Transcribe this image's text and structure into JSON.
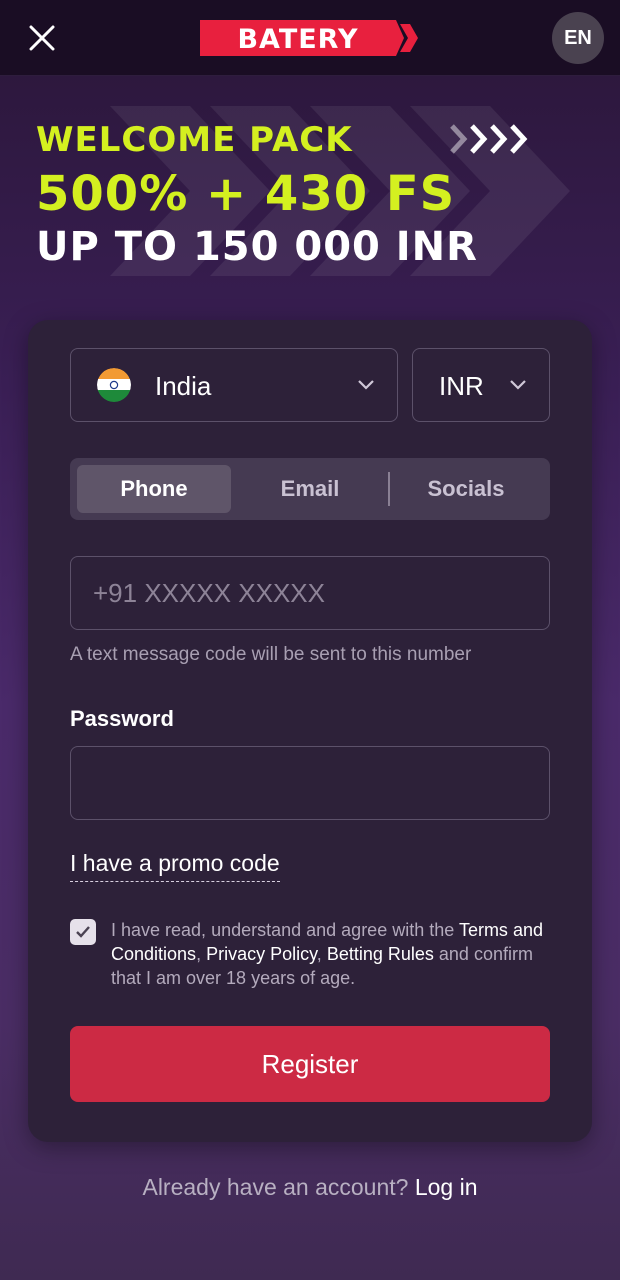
{
  "header": {
    "brand": "BATERY",
    "language": "EN",
    "colors": {
      "brand": "#e8203e",
      "accent": "#d4f020"
    }
  },
  "banner": {
    "line1": "WELCOME PACK",
    "line2": "500% + 430 FS",
    "line3": "UP TO 150 000 INR"
  },
  "form": {
    "country": {
      "label": "India",
      "flag": "india-flag-icon"
    },
    "currency": {
      "label": "INR"
    },
    "tabs": [
      {
        "label": "Phone",
        "active": true
      },
      {
        "label": "Email",
        "active": false
      },
      {
        "label": "Socials",
        "active": false
      }
    ],
    "phone": {
      "placeholder": "+91 XXXXX XXXXX",
      "hint": "A text message code will be sent to this number"
    },
    "password": {
      "label": "Password",
      "value": ""
    },
    "promo_link": "I have a promo code",
    "terms": {
      "checked": true,
      "prefix": "I have read, understand and agree with the",
      "link1": "Terms and Conditions",
      "sep1": ",",
      "link2": "Privacy Policy",
      "sep2": ",",
      "link3": "Betting Rules",
      "suffix": "and confirm that I am over 18 years of age."
    },
    "register_label": "Register"
  },
  "footer": {
    "text": "Already have an account?",
    "login_label": "Log in"
  }
}
